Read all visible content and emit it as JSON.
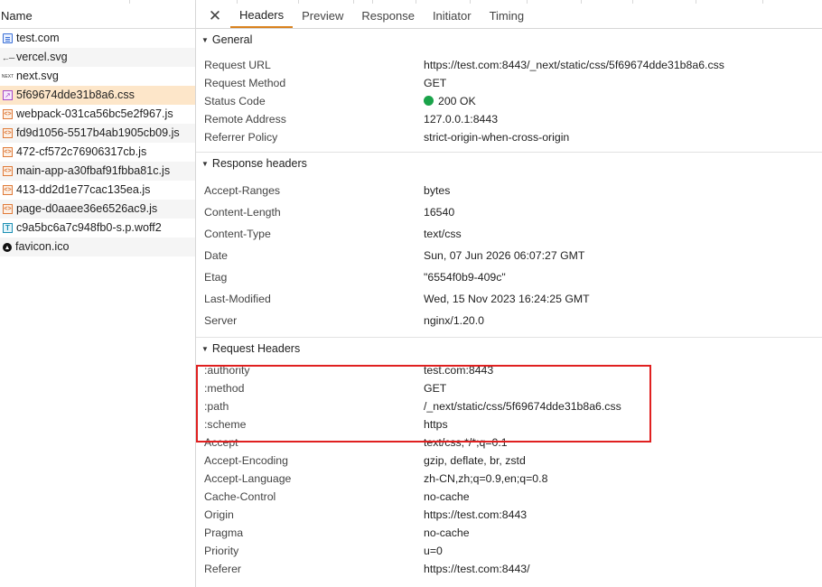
{
  "left": {
    "header": "Name",
    "files": [
      {
        "name": "test.com",
        "icon": "document-icon"
      },
      {
        "name": "vercel.svg",
        "icon": "svg-file-icon"
      },
      {
        "name": "next.svg",
        "icon": "svg-file-icon"
      },
      {
        "name": "5f69674dde31b8a6.css",
        "icon": "css-file-icon"
      },
      {
        "name": "webpack-031ca56bc5e2f967.js",
        "icon": "js-file-icon"
      },
      {
        "name": "fd9d1056-5517b4ab1905cb09.js",
        "icon": "js-file-icon"
      },
      {
        "name": "472-cf572c76906317cb.js",
        "icon": "js-file-icon"
      },
      {
        "name": "main-app-a30fbaf91fbba81c.js",
        "icon": "js-file-icon"
      },
      {
        "name": "413-dd2d1e77cac135ea.js",
        "icon": "js-file-icon"
      },
      {
        "name": "page-d0aaee36e6526ac9.js",
        "icon": "js-file-icon"
      },
      {
        "name": "c9a5bc6a7c948fb0-s.p.woff2",
        "icon": "font-file-icon"
      },
      {
        "name": "favicon.ico",
        "icon": "favicon-icon"
      }
    ],
    "selected_index": 3
  },
  "tabs": [
    "Headers",
    "Preview",
    "Response",
    "Initiator",
    "Timing"
  ],
  "active_tab": "Headers",
  "general": {
    "title": "General",
    "rows": [
      {
        "key": "Request URL",
        "value": "https://test.com:8443/_next/static/css/5f69674dde31b8a6.css"
      },
      {
        "key": "Request Method",
        "value": "GET"
      },
      {
        "key": "Status Code",
        "value": "200 OK"
      },
      {
        "key": "Remote Address",
        "value": "127.0.0.1:8443"
      },
      {
        "key": "Referrer Policy",
        "value": "strict-origin-when-cross-origin"
      }
    ]
  },
  "response_headers": {
    "title": "Response headers",
    "rows": [
      {
        "key": "Accept-Ranges",
        "value": "bytes"
      },
      {
        "key": "Content-Length",
        "value": "16540"
      },
      {
        "key": "Content-Type",
        "value": "text/css"
      },
      {
        "key": "Date",
        "value": "Sun, 07 Jun 2026 06:07:27 GMT"
      },
      {
        "key": "Etag",
        "value": "\"6554f0b9-409c\""
      },
      {
        "key": "Last-Modified",
        "value": "Wed, 15 Nov 2023 16:24:25 GMT"
      },
      {
        "key": "Server",
        "value": "nginx/1.20.0"
      }
    ]
  },
  "request_headers": {
    "title": "Request Headers",
    "rows": [
      {
        "key": ":authority",
        "value": "test.com:8443"
      },
      {
        "key": ":method",
        "value": "GET"
      },
      {
        "key": ":path",
        "value": "/_next/static/css/5f69674dde31b8a6.css"
      },
      {
        "key": ":scheme",
        "value": "https"
      },
      {
        "key": "Accept",
        "value": "text/css,*/*;q=0.1"
      },
      {
        "key": "Accept-Encoding",
        "value": "gzip, deflate, br, zstd"
      },
      {
        "key": "Accept-Language",
        "value": "zh-CN,zh;q=0.9,en;q=0.8"
      },
      {
        "key": "Cache-Control",
        "value": "no-cache"
      },
      {
        "key": "Origin",
        "value": "https://test.com:8443"
      },
      {
        "key": "Pragma",
        "value": "no-cache"
      },
      {
        "key": "Priority",
        "value": "u=0"
      },
      {
        "key": "Referer",
        "value": "https://test.com:8443/"
      }
    ]
  },
  "colors": {
    "status_ok": "#1aa34a",
    "active_tab_underline": "#d9821e",
    "selected_row": "#fde6c9",
    "highlight_box": "#e02020"
  }
}
